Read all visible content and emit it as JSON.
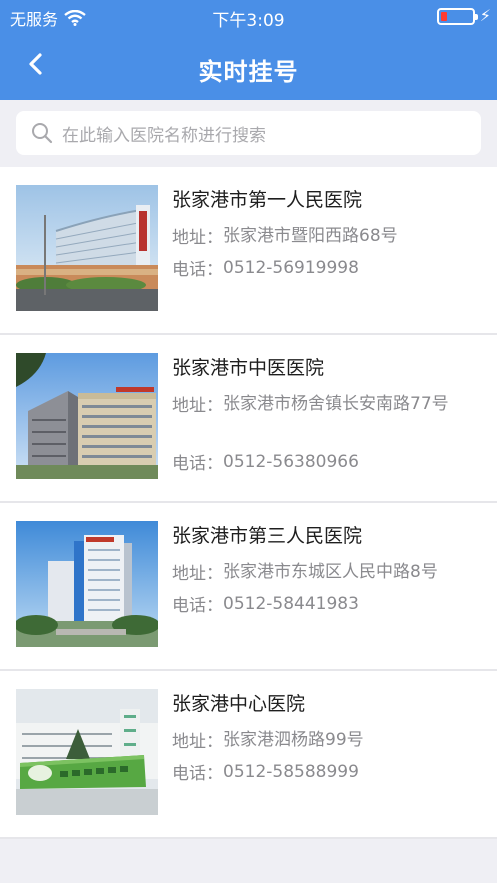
{
  "status": {
    "carrier": "无服务",
    "time": "下午3:09"
  },
  "header": {
    "title": "实时挂号"
  },
  "search": {
    "placeholder": "在此输入医院名称进行搜索"
  },
  "hospitals": [
    {
      "name": "张家港市第一人民医院",
      "address_label": "地址：",
      "address": "张家港市暨阳西路68号",
      "phone_label": "电话：",
      "phone": "0512-56919998"
    },
    {
      "name": "张家港市中医医院",
      "address_label": "地址：",
      "address": "张家港市杨舍镇长安南路77号",
      "phone_label": "电话：",
      "phone": "0512-56380966"
    },
    {
      "name": "张家港市第三人民医院",
      "address_label": "地址：",
      "address": "张家港市东城区人民中路8号",
      "phone_label": "电话：",
      "phone": "0512-58441983"
    },
    {
      "name": "张家港中心医院",
      "address_label": "地址：",
      "address": "张家港泗杨路99号",
      "phone_label": "电话：",
      "phone": "0512-58588999"
    }
  ],
  "colors": {
    "accent": "#4a8fe7",
    "background": "#efeff4",
    "battery_low": "#ff3b30"
  }
}
